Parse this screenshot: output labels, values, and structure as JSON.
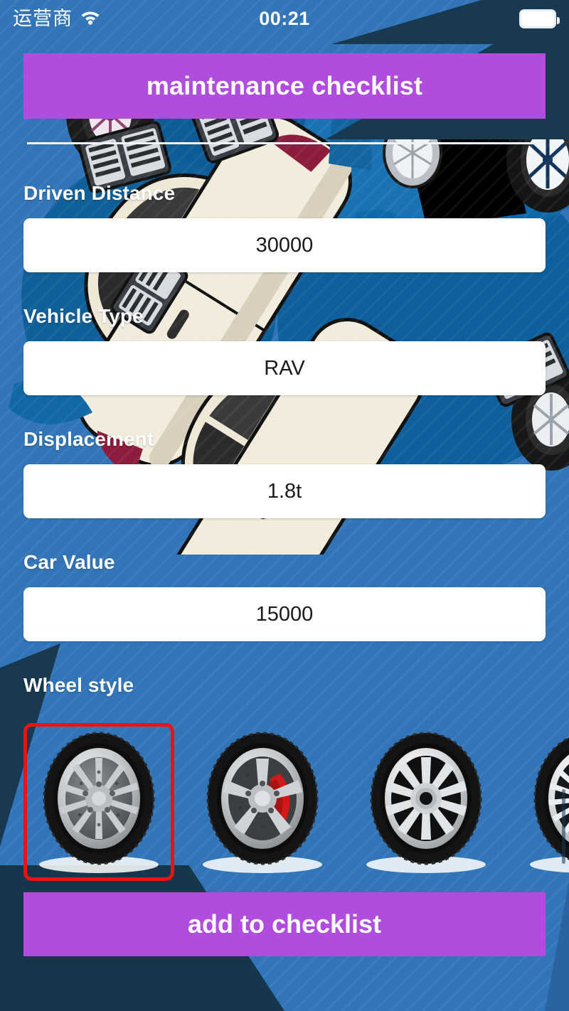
{
  "status_bar": {
    "carrier": "运营商",
    "wifi_icon": "wifi-icon",
    "time": "00:21",
    "battery_icon": "battery-full-icon"
  },
  "header": {
    "title": "maintenance checklist",
    "accent_color": "#b04ddf"
  },
  "form": {
    "fields": [
      {
        "label": "Driven Distance",
        "value": "30000",
        "name": "driven-distance"
      },
      {
        "label": "Vehicle Type",
        "value": "RAV",
        "name": "vehicle-type"
      },
      {
        "label": "Displacement",
        "value": "1.8t",
        "name": "displacement"
      },
      {
        "label": "Car Value",
        "value": "15000",
        "name": "car-value"
      }
    ]
  },
  "wheel_picker": {
    "label": "Wheel style",
    "selected_index": 0,
    "selection_color": "#ee1111",
    "options": [
      {
        "name": "wheel-option-1",
        "style": "10-spoke alloy"
      },
      {
        "name": "wheel-option-2",
        "style": "5-spoke alloy red caliper"
      },
      {
        "name": "wheel-option-3",
        "style": "10-spoke hubcap"
      },
      {
        "name": "wheel-option-4",
        "style": "multi-spoke blue center"
      }
    ]
  },
  "cta": {
    "label": "add to checklist"
  },
  "theme": {
    "background_blue": "#3175b8",
    "background_dark": "#18394f",
    "purple": "#b04ddf",
    "input_background": "#ffffff"
  }
}
